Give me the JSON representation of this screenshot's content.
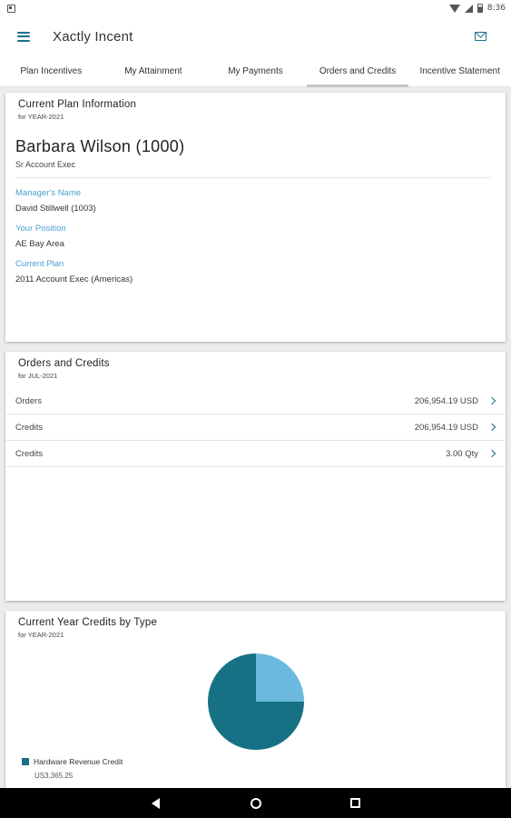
{
  "status_bar": {
    "time": "8:36",
    "icons": [
      "notification-icon",
      "wifi-icon",
      "signal-icon",
      "battery-icon"
    ]
  },
  "app_bar": {
    "title": "Xactly Incent",
    "menu_icon": "hamburger-menu-icon",
    "action_icon": "mail-icon"
  },
  "tabs": [
    {
      "label": "Plan Incentives",
      "active": false
    },
    {
      "label": "My Attainment",
      "active": false
    },
    {
      "label": "My Payments",
      "active": false
    },
    {
      "label": "Orders and Credits",
      "active": true
    },
    {
      "label": "Incentive Statement",
      "active": false
    }
  ],
  "plan_card": {
    "title": "Current Plan Information",
    "subtitle": "for YEAR-2021",
    "employee_name": "Barbara Wilson (1000)",
    "employee_title": "Sr Account Exec",
    "fields": [
      {
        "label": "Manager's Name",
        "value": "David Stillwell (1003)"
      },
      {
        "label": "Your Position",
        "value": "AE Bay Area"
      },
      {
        "label": "Current Plan",
        "value": "2011 Account Exec (Americas)"
      }
    ]
  },
  "orders_card": {
    "title": "Orders and Credits",
    "subtitle": "for JUL-2021",
    "rows": [
      {
        "label": "Orders",
        "value": "206,954.19 USD"
      },
      {
        "label": "Credits",
        "value": "206,954.19 USD"
      },
      {
        "label": "Credits",
        "value": "3.00 Qty"
      }
    ]
  },
  "credits_card": {
    "title": "Current Year Credits by Type",
    "subtitle": "for YEAR-2021",
    "legend_label": "Hardware Revenue Credit",
    "legend_value": "US3,365.25"
  },
  "chart_data": {
    "type": "pie",
    "slices": [
      {
        "color": "#177185",
        "fraction": 0.75
      },
      {
        "color": "#6cb9df",
        "fraction": 0.25
      }
    ],
    "legend": [
      {
        "label": "Hardware Revenue Credit",
        "color": "#177185",
        "value": "US3,365.25"
      }
    ]
  },
  "nav_bar": {
    "icons": [
      "back-icon",
      "home-icon",
      "recents-icon"
    ]
  }
}
